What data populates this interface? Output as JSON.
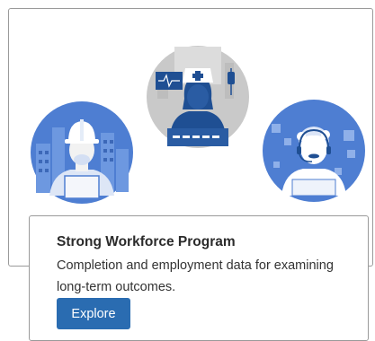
{
  "card": {
    "title": "Strong Workforce Program",
    "description": "Completion and employment data for examining long-term outcomes.",
    "button_label": "Explore"
  },
  "illustration": {
    "icons": [
      "construction-worker-icon",
      "nurse-icon",
      "call-center-agent-icon"
    ]
  },
  "colors": {
    "button": "#2a6cb1",
    "circle_blue": "#4e7ed2",
    "circle_gray": "#c9c9c9",
    "figure_dark": "#1f4f93"
  }
}
